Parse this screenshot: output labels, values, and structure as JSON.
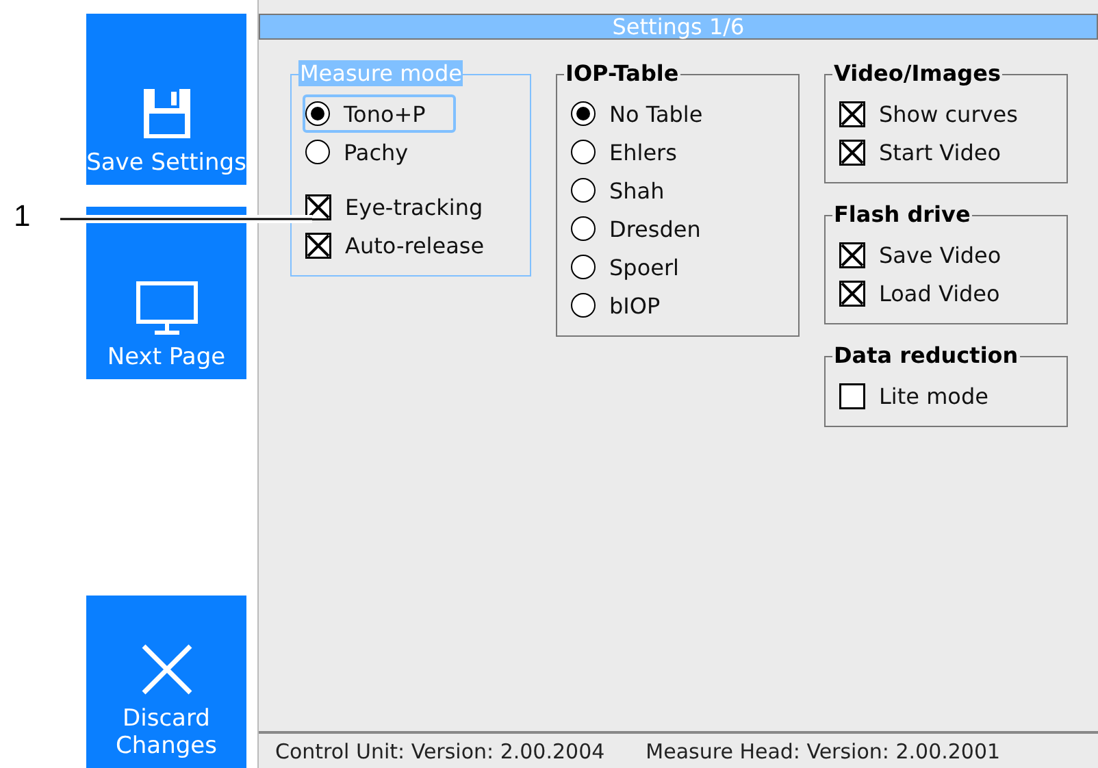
{
  "sidebar": {
    "buttons": [
      {
        "kind": "save",
        "label": "Save Settings"
      },
      {
        "kind": "next",
        "label": "Next Page"
      },
      {
        "kind": "discard",
        "label": "Discard Changes"
      }
    ]
  },
  "callout": {
    "label": "1"
  },
  "panel": {
    "title": "Settings 1/6",
    "columns": [
      [
        {
          "title": "Measure mode",
          "focused": true,
          "items": [
            {
              "kind": "radio",
              "label": "Tono+P",
              "selected": true,
              "focused": true
            },
            {
              "kind": "radio",
              "label": "Pachy",
              "selected": false,
              "focused": false
            },
            {
              "kind": "checkbox",
              "label": "Eye-tracking",
              "checked": true,
              "focused": false
            },
            {
              "kind": "checkbox",
              "label": "Auto-release",
              "checked": true,
              "focused": false
            }
          ]
        }
      ],
      [
        {
          "title": "IOP-Table",
          "focused": false,
          "items": [
            {
              "kind": "radio",
              "label": "No Table",
              "selected": true,
              "focused": false
            },
            {
              "kind": "radio",
              "label": "Ehlers",
              "selected": false,
              "focused": false
            },
            {
              "kind": "radio",
              "label": "Shah",
              "selected": false,
              "focused": false
            },
            {
              "kind": "radio",
              "label": "Dresden",
              "selected": false,
              "focused": false
            },
            {
              "kind": "radio",
              "label": "Spoerl",
              "selected": false,
              "focused": false
            },
            {
              "kind": "radio",
              "label": "bIOP",
              "selected": false,
              "focused": false
            }
          ]
        }
      ],
      [
        {
          "title": "Video/Images",
          "focused": false,
          "items": [
            {
              "kind": "checkbox",
              "label": "Show curves",
              "checked": true,
              "focused": false
            },
            {
              "kind": "checkbox",
              "label": "Start Video",
              "checked": true,
              "focused": false
            }
          ]
        },
        {
          "title": "Flash drive",
          "focused": false,
          "items": [
            {
              "kind": "checkbox",
              "label": "Save Video",
              "checked": true,
              "focused": false
            },
            {
              "kind": "checkbox",
              "label": "Load Video",
              "checked": true,
              "focused": false
            }
          ]
        },
        {
          "title": "Data reduction",
          "focused": false,
          "items": [
            {
              "kind": "checkbox",
              "label": "Lite mode",
              "checked": false,
              "focused": false
            }
          ]
        }
      ]
    ]
  },
  "status_bar": {
    "texts": [
      "Control Unit: Version:  2.00.2004",
      "Measure Head: Version:  2.00.2001"
    ]
  }
}
